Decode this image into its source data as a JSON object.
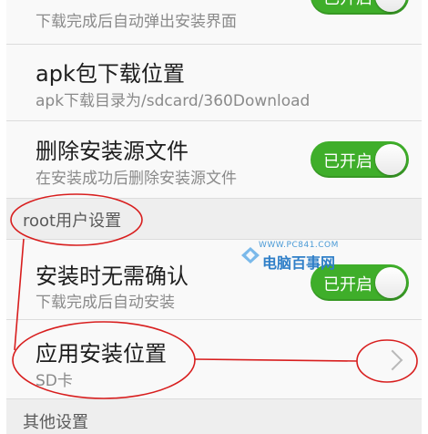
{
  "settings": {
    "auto_popup": {
      "subtitle": "下载完成后自动弹出安装界面",
      "toggle_label": "已开启",
      "enabled": true
    },
    "apk_location": {
      "title": "apk包下载位置",
      "subtitle": "apk下载目录为/sdcard/360Download"
    },
    "delete_source": {
      "title": "删除安装源文件",
      "subtitle": "在安装成功后删除安装源文件",
      "toggle_label": "已开启",
      "enabled": true
    },
    "root_section": {
      "title": "root用户设置"
    },
    "no_confirm": {
      "title": "安装时无需确认",
      "subtitle": "下载完成后自动安装",
      "toggle_label": "已开启",
      "enabled": true
    },
    "install_location": {
      "title": "应用安装位置",
      "subtitle": "SD卡"
    },
    "other_section": {
      "title": "其他设置"
    }
  },
  "watermark": {
    "site": "WWW.PC841.COM",
    "name": "电脑百事网"
  },
  "colors": {
    "toggle_on": "#3fae2a",
    "annotation": "#d81e1e",
    "watermark": "#2f7fc8"
  }
}
